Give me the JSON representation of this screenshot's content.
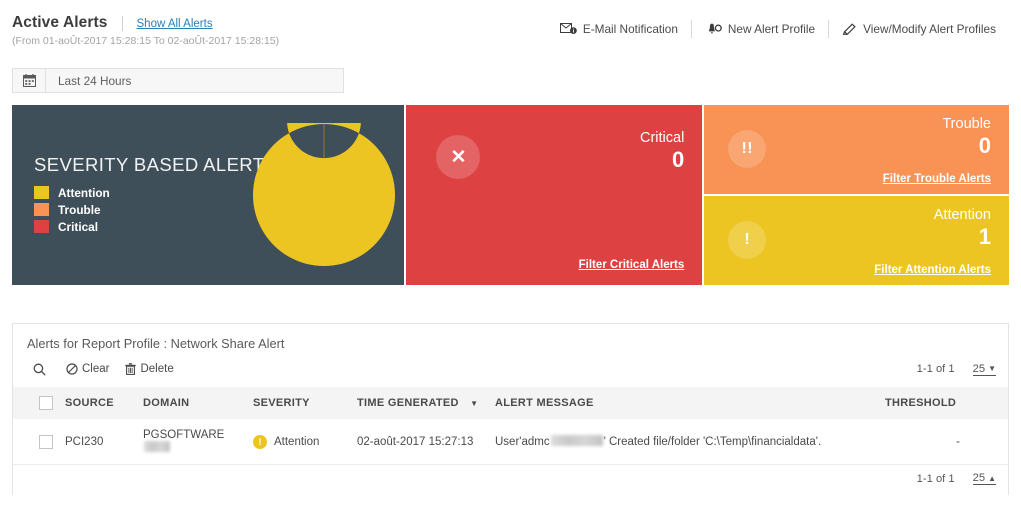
{
  "header": {
    "title": "Active Alerts",
    "show_all_link": "Show All Alerts",
    "date_range": "(From 01-aoÛt-2017 15:28:15 To 02-aoÛt-2017 15:28:15)",
    "actions": [
      {
        "label": "E-Mail Notification",
        "icon": "envelope-info-icon"
      },
      {
        "label": "New Alert Profile",
        "icon": "bell-plus-icon"
      },
      {
        "label": "View/Modify Alert Profiles",
        "icon": "pencil-icon"
      }
    ]
  },
  "time_filter": {
    "icon": "calendar-icon",
    "value": "Last 24 Hours"
  },
  "severity_card": {
    "heading": "SEVERITY BASED ALERTS",
    "legend": [
      {
        "label": "Attention",
        "color": "#EDC523"
      },
      {
        "label": "Trouble",
        "color": "#F89355"
      },
      {
        "label": "Critical",
        "color": "#DE4142"
      }
    ]
  },
  "chart_data": {
    "type": "pie",
    "title": "SEVERITY BASED ALERTS",
    "categories": [
      "Attention",
      "Trouble",
      "Critical"
    ],
    "values": [
      1,
      0,
      0
    ],
    "colors": [
      "#EDC523",
      "#F89355",
      "#DE4142"
    ],
    "donut": true,
    "inner_radius_ratio": 0.52,
    "legend_position": "left",
    "grid": false
  },
  "cards": [
    {
      "key": "critical",
      "label": "Critical",
      "count": "0",
      "link": "Filter Critical Alerts",
      "icon": "close-x-icon",
      "icon_glyph": "✕",
      "color": "#DE4142"
    },
    {
      "key": "trouble",
      "label": "Trouble",
      "count": "0",
      "link": "Filter Trouble Alerts",
      "icon": "double-exclamation-icon",
      "icon_glyph": "!!",
      "color": "#F89355"
    },
    {
      "key": "attention",
      "label": "Attention",
      "count": "1",
      "link": "Filter Attention Alerts",
      "icon": "exclamation-icon",
      "icon_glyph": "!",
      "color": "#EDC523"
    }
  ],
  "alerts_panel": {
    "title": "Alerts for Report Profile : Network Share Alert",
    "toolbar": {
      "search_icon": "search-icon",
      "clear_label": "Clear",
      "clear_icon": "ban-circle-icon",
      "delete_label": "Delete",
      "delete_icon": "trash-icon"
    },
    "pager_top": {
      "range": "1-1 of 1",
      "page_size": "25",
      "caret": "▼"
    },
    "pager_bottom": {
      "range": "1-1 of 1",
      "page_size": "25",
      "caret": "▲"
    },
    "columns": [
      "SOURCE",
      "DOMAIN",
      "SEVERITY",
      "TIME GENERATED",
      "ALERT MESSAGE",
      "THRESHOLD"
    ],
    "sorted_column": "TIME GENERATED",
    "sort_caret": "▼",
    "rows": [
      {
        "source": "PCI230",
        "domain": "PGSOFTWARE",
        "domain_redacted": true,
        "severity": "Attention",
        "severity_glyph": "!",
        "time_generated": "02-août-2017 15:27:13",
        "message_prefix": "User'admc",
        "message_suffix": "' Created file/folder 'C:\\Temp\\financialdata'.",
        "message_redacted": true,
        "threshold": "-"
      }
    ]
  }
}
